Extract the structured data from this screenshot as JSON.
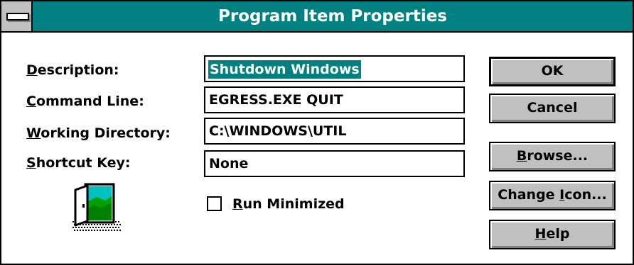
{
  "window": {
    "title": "Program Item Properties"
  },
  "fields": [
    {
      "label_mnemonic": "D",
      "label_rest": "escription:",
      "value": "Shutdown Windows"
    },
    {
      "label_mnemonic": "C",
      "label_rest": "ommand Line:",
      "value": "EGRESS.EXE QUIT"
    },
    {
      "label_mnemonic": "W",
      "label_rest": "orking Directory:",
      "value": "C:\\WINDOWS\\UTIL"
    },
    {
      "label_mnemonic": "S",
      "label_rest": "hortcut Key:",
      "value": "None"
    }
  ],
  "checkbox": {
    "label_mnemonic": "R",
    "label_rest": "un Minimized",
    "checked": false
  },
  "buttons": {
    "ok": "OK",
    "cancel": "Cancel",
    "browse_mnemonic": "B",
    "browse_rest": "rowse...",
    "change_icon_before": "Change ",
    "change_icon_mnemonic": "I",
    "change_icon_after": "con...",
    "help_mnemonic": "H",
    "help_rest": "elp"
  },
  "icon": {
    "name": "program-door-icon"
  },
  "colors": {
    "titlebar": "#008080",
    "selection": "#008080",
    "button_face": "#c0c0c0"
  }
}
